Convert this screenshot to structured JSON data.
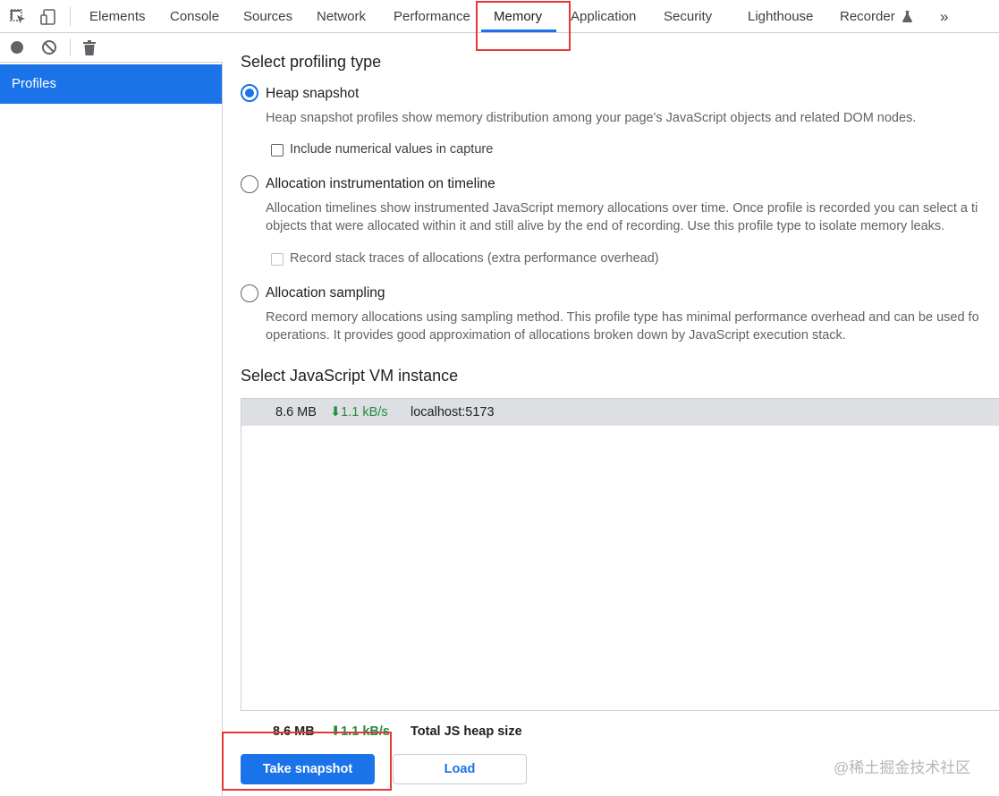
{
  "tabs": {
    "elements": "Elements",
    "console": "Console",
    "sources": "Sources",
    "network": "Network",
    "performance": "Performance",
    "memory": "Memory",
    "application": "Application",
    "security": "Security",
    "lighthouse": "Lighthouse",
    "recorder": "Recorder",
    "more": "»",
    "active": "Memory"
  },
  "sidebar": {
    "items": [
      {
        "label": "Profiles",
        "selected": true
      }
    ]
  },
  "profiling": {
    "heading": "Select profiling type",
    "options": [
      {
        "label": "Heap snapshot",
        "selected": true,
        "description": [
          "Heap snapshot profiles show memory distribution among your page's JavaScript objects and related DOM nodes."
        ],
        "checkbox": {
          "label": "Include numerical values in capture",
          "checked": false,
          "disabled": false
        }
      },
      {
        "label": "Allocation instrumentation on timeline",
        "selected": false,
        "description": [
          "Allocation timelines show instrumented JavaScript memory allocations over time. Once profile is recorded you can select a ti",
          "objects that were allocated within it and still alive by the end of recording. Use this profile type to isolate memory leaks."
        ],
        "checkbox": {
          "label": "Record stack traces of allocations (extra performance overhead)",
          "checked": false,
          "disabled": true
        }
      },
      {
        "label": "Allocation sampling",
        "selected": false,
        "description": [
          "Record memory allocations using sampling method. This profile type has minimal performance overhead and can be used fo",
          "operations. It provides good approximation of allocations broken down by JavaScript execution stack."
        ]
      }
    ]
  },
  "vm": {
    "heading": "Select JavaScript VM instance",
    "rows": [
      {
        "size": "8.6 MB",
        "rate": "⬇1.1 kB/s",
        "name": "localhost:5173"
      }
    ]
  },
  "total": {
    "size": "8.6 MB",
    "rate": "⬇1.1 kB/s",
    "label": "Total JS heap size"
  },
  "buttons": {
    "take_snapshot": "Take snapshot",
    "load": "Load"
  },
  "watermark": "@稀土掘金技术社区",
  "colors": {
    "accent": "#1a73e8",
    "highlight_box": "#e53935",
    "rate_green": "#1e8e3e"
  }
}
